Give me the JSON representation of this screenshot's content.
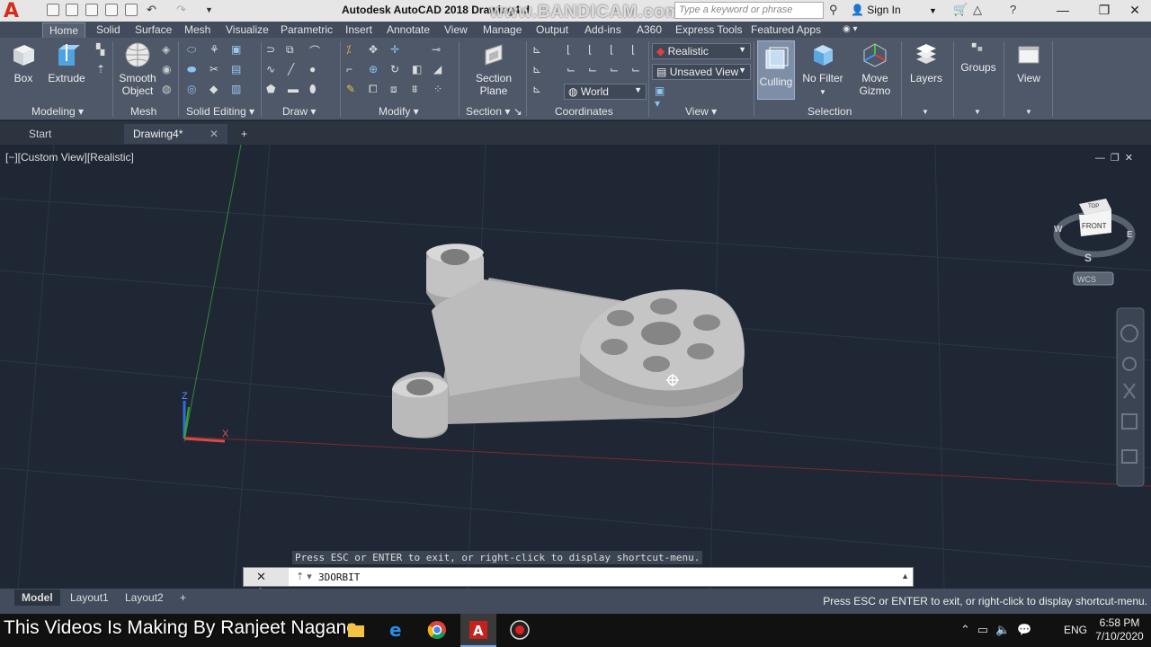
{
  "titlebar": {
    "app_letter": "A",
    "title": "Autodesk AutoCAD 2018",
    "doc_name": "Drawing4.d",
    "watermark": "www.BANDICAM.com",
    "search_placeholder": "Type a keyword or phrase",
    "signin": "Sign In"
  },
  "ribbon_tabs": [
    "Home",
    "Solid",
    "Surface",
    "Mesh",
    "Visualize",
    "Parametric",
    "Insert",
    "Annotate",
    "View",
    "Manage",
    "Output",
    "Add-ins",
    "A360",
    "Express Tools",
    "Featured Apps"
  ],
  "ribbon": {
    "box": "Box",
    "extrude": "Extrude",
    "smooth_object_1": "Smooth",
    "smooth_object_2": "Object",
    "section_plane_1": "Section",
    "section_plane_2": "Plane",
    "visual_style": "Realistic",
    "named_view": "Unsaved View",
    "coord_system": "World",
    "culling": "Culling",
    "no_filter": "No Filter",
    "move_gizmo_1": "Move",
    "move_gizmo_2": "Gizmo",
    "layers": "Layers",
    "groups": "Groups",
    "view": "View",
    "panels": {
      "modeling": "Modeling",
      "mesh": "Mesh",
      "solid_editing": "Solid Editing",
      "draw": "Draw",
      "modify": "Modify",
      "section": "Section",
      "coordinates": "Coordinates",
      "view": "View",
      "selection": "Selection"
    }
  },
  "file_tabs": {
    "start": "Start",
    "drawing": "Drawing4*"
  },
  "viewport": {
    "label": "[−][Custom View][Realistic]",
    "viewcube_top": "TOP",
    "viewcube_front": "FRONT",
    "compass_w": "W",
    "compass_e": "E",
    "compass_s": "S",
    "wcs": "WCS",
    "axis_x": "X",
    "axis_z": "Z"
  },
  "command": {
    "prompt": "Press ESC or ENTER to exit, or right-click to display shortcut-menu.",
    "current": "3DORBIT"
  },
  "status": {
    "tabs": [
      "Model",
      "Layout1",
      "Layout2"
    ],
    "message": "Press ESC or ENTER to exit, or right-click to display shortcut-menu."
  },
  "taskbar": {
    "caption": "This Videos Is Making By Ranjeet Nagane",
    "lang": "ENG",
    "time": "6:58 PM",
    "date": "7/10/2020"
  },
  "colors": {
    "viewport_bg": "#1f2734",
    "ribbon_bg": "#4e5869",
    "part_gray": "#b9b9b9",
    "autocad_red": "#d92a1c"
  }
}
